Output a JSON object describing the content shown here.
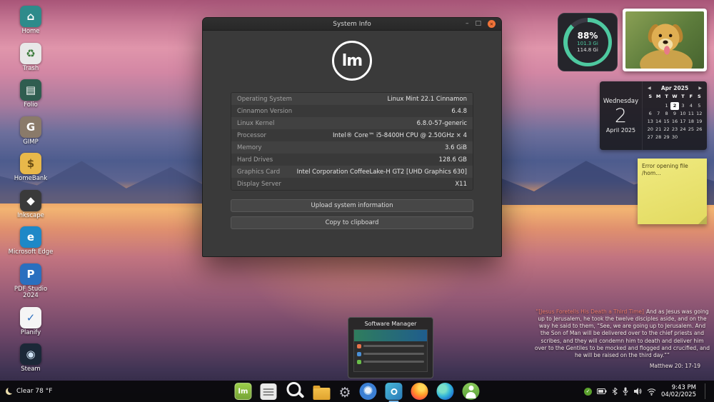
{
  "desktop": {
    "icons": [
      {
        "name": "home",
        "label": "Home",
        "glyph": "⌂",
        "bg": "#2e8b8b",
        "fg": "#ffffff"
      },
      {
        "name": "trash",
        "label": "Trash",
        "glyph": "♻",
        "bg": "#e8e8e8",
        "fg": "#3a7a3a"
      },
      {
        "name": "folio",
        "label": "Folio",
        "glyph": "▤",
        "bg": "#2f5d50",
        "fg": "#ffffff"
      },
      {
        "name": "gimp",
        "label": "GIMP",
        "glyph": "G",
        "bg": "#8a7a6a",
        "fg": "#ffffff"
      },
      {
        "name": "homebank",
        "label": "HomeBank",
        "glyph": "$",
        "bg": "#e8b84a",
        "fg": "#6b4e14"
      },
      {
        "name": "inkscape",
        "label": "Inkscape",
        "glyph": "◆",
        "bg": "#3a3a3a",
        "fg": "#ffffff"
      },
      {
        "name": "microsoft-edge",
        "label": "Microsoft Edge",
        "glyph": "e",
        "bg": "#1e88c7",
        "fg": "#ffffff"
      },
      {
        "name": "pdf-studio-2024",
        "label": "PDF Studio 2024",
        "glyph": "P",
        "bg": "#2a6fbf",
        "fg": "#ffffff"
      },
      {
        "name": "planify",
        "label": "Planify",
        "glyph": "✓",
        "bg": "#f5f5f5",
        "fg": "#2a6fbf"
      },
      {
        "name": "steam",
        "label": "Steam",
        "glyph": "◉",
        "bg": "#1b2838",
        "fg": "#cfe3f5"
      }
    ]
  },
  "window": {
    "title": "System Info",
    "controls": {
      "minimize": "–",
      "maximize": "□",
      "close": "✕"
    },
    "logo_text": "lm",
    "rows": [
      {
        "label": "Operating System",
        "value": "Linux Mint 22.1 Cinnamon"
      },
      {
        "label": "Cinnamon Version",
        "value": "6.4.8"
      },
      {
        "label": "Linux Kernel",
        "value": "6.8.0-57-generic"
      },
      {
        "label": "Processor",
        "value": "Intel® Core™ i5-8400H CPU @ 2.50GHz × 4"
      },
      {
        "label": "Memory",
        "value": "3.6 GiB"
      },
      {
        "label": "Hard Drives",
        "value": "128.6 GB"
      },
      {
        "label": "Graphics Card",
        "value": "Intel Corporation CoffeeLake-H GT2 [UHD Graphics 630]"
      },
      {
        "label": "Display Server",
        "value": "X11"
      }
    ],
    "buttons": [
      {
        "label": "Upload system information"
      },
      {
        "label": "Copy to clipboard"
      }
    ]
  },
  "widgets": {
    "disk": {
      "percent": "88%",
      "free": "101.3 Gi",
      "total": "114.8 Gi",
      "ring_color": "#4ec9a0"
    },
    "calendar": {
      "day_name": "Wednesday",
      "day_number": "2",
      "month_year": "April 2025",
      "header": "Apr 2025",
      "prev": "◀",
      "next": "▶",
      "weekdays": [
        {
          "d": "S"
        },
        {
          "d": "M"
        },
        {
          "d": "T"
        },
        {
          "d": "W"
        },
        {
          "d": "T"
        },
        {
          "d": "F"
        },
        {
          "d": "S"
        }
      ],
      "days": [
        {
          "d": ""
        },
        {
          "d": ""
        },
        {
          "d": "1"
        },
        {
          "d": "2",
          "cls": "today"
        },
        {
          "d": "3"
        },
        {
          "d": "4"
        },
        {
          "d": "5"
        },
        {
          "d": "6"
        },
        {
          "d": "7"
        },
        {
          "d": "8"
        },
        {
          "d": "9"
        },
        {
          "d": "10"
        },
        {
          "d": "11"
        },
        {
          "d": "12"
        },
        {
          "d": "13"
        },
        {
          "d": "14"
        },
        {
          "d": "15"
        },
        {
          "d": "16"
        },
        {
          "d": "17"
        },
        {
          "d": "18"
        },
        {
          "d": "19"
        },
        {
          "d": "20"
        },
        {
          "d": "21"
        },
        {
          "d": "22"
        },
        {
          "d": "23"
        },
        {
          "d": "24"
        },
        {
          "d": "25"
        },
        {
          "d": "26"
        },
        {
          "d": "27"
        },
        {
          "d": "28"
        },
        {
          "d": "29"
        },
        {
          "d": "30"
        },
        {
          "d": ""
        },
        {
          "d": ""
        },
        {
          "d": ""
        }
      ]
    },
    "note": {
      "text": "Error opening file /hom…"
    },
    "preview": {
      "title": "Software Manager"
    },
    "verse": {
      "title": "“[Jesus Foretells His Death a Third Time]",
      "body": "And as Jesus was going up to Jerusalem, he took the twelve disciples aside, and on the way he said to them, “See, we are going up to Jerusalem. And the Son of Man will be delivered over to the chief priests and scribes, and they will condemn him to death and deliver him over to the Gentiles to be mocked and flogged and crucified, and he will be raised on the third day.””",
      "reference": "Matthew 20: 17-19"
    }
  },
  "taskbar": {
    "weather": "Clear 78 °F",
    "launcher_icons": [
      "mint-menu-icon",
      "files-icon",
      "search-icon",
      "folder-icon",
      "settings-gear-icon",
      "chromium-icon",
      "software-manager-icon",
      "firefox-icon",
      "edge-icon",
      "user-icon"
    ],
    "tray_icons": [
      "updates-check-icon",
      "battery-icon",
      "bluetooth-icon",
      "microphone-icon",
      "volume-icon",
      "network-icon"
    ],
    "clock": {
      "time": "9:43 PM",
      "date": "04/02/2025"
    }
  }
}
